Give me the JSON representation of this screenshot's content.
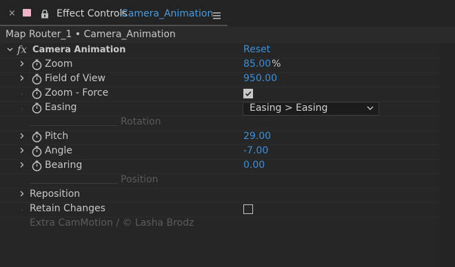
{
  "header": {
    "close_glyph": "×",
    "title": "Effect Controls",
    "layer_name": "Camera_Animation",
    "swatch_color": "#f0b6c8"
  },
  "breadcrumb": {
    "text": "Map Router_1 • Camera_Animation"
  },
  "effect": {
    "fx_label": "fx",
    "name": "Camera Animation",
    "reset_label": "Reset"
  },
  "properties": {
    "zoom": {
      "label": "Zoom",
      "value": "85.00",
      "unit": "%"
    },
    "fov": {
      "label": "Field of View",
      "value": "950.00"
    },
    "zoom_force": {
      "label": "Zoom - Force",
      "checked": true
    },
    "easing": {
      "label": "Easing",
      "selected": "Easing > Easing"
    },
    "rotation_group": "Rotation",
    "pitch": {
      "label": "Pitch",
      "value": "29.00"
    },
    "angle": {
      "label": "Angle",
      "value": "-7.00"
    },
    "bearing": {
      "label": "Bearing",
      "value": "0.00"
    },
    "position_group": "Position",
    "reposition": {
      "label": "Reposition"
    },
    "retain": {
      "label": "Retain Changes",
      "checked": false
    },
    "credit": "Extra CamMotion / © Lasha Brodz"
  },
  "colors": {
    "value_blue": "#3c8fdb",
    "layer_blue": "#4b9dde",
    "background": "#262626"
  }
}
